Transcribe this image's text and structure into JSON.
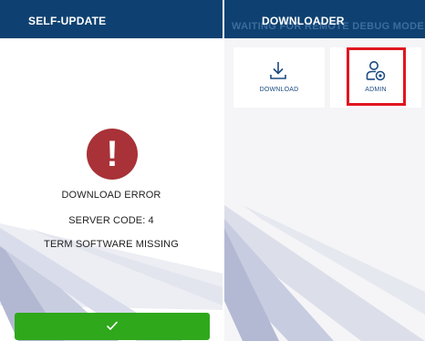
{
  "self_update": {
    "title": "SELF-UPDATE",
    "error": {
      "line1": "DOWNLOAD ERROR",
      "line2": "SERVER CODE: 4",
      "line3": "TERM SOFTWARE MISSING"
    },
    "confirm_icon": "check-icon"
  },
  "downloader": {
    "title": "DOWNLOADER",
    "ghost_text": "WAITING FOR REMOTE DEBUG MODE",
    "tiles": [
      {
        "label": "DOWNLOAD",
        "icon": "download-icon"
      },
      {
        "label": "ADMIN",
        "icon": "admin-icon"
      }
    ],
    "highlighted_tile": "ADMIN"
  },
  "colors": {
    "header": "#0e4171",
    "error": "#a83237",
    "confirm": "#2fa81c",
    "highlight": "#e0161f",
    "tile_label": "#1a4a80"
  }
}
